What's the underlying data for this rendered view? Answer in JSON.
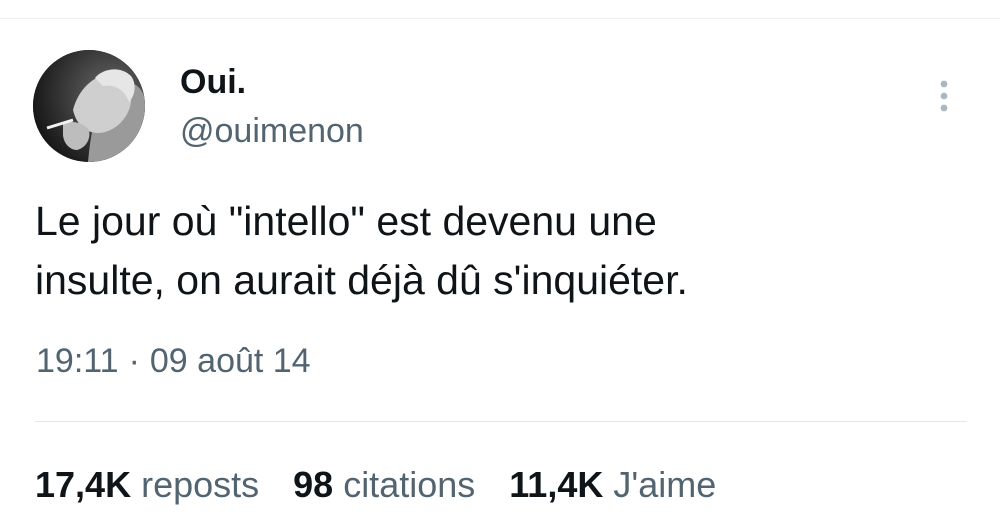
{
  "tweet": {
    "author": {
      "display_name": "Oui.",
      "handle": "@ouimenon",
      "avatar_icon": "profile-photo"
    },
    "menu_icon": "more-vertical-icon",
    "text": "Le jour où \"intello\" est devenu une\ninsulte, on aurait déjà dû s'inquiéter.",
    "time": "19:11",
    "separator": "·",
    "date": "09 août 14",
    "stats": {
      "reposts": {
        "count": "17,4K",
        "label": "reposts"
      },
      "quotes": {
        "count": "98",
        "label": "citations"
      },
      "likes": {
        "count": "11,4K",
        "label": "J'aime"
      }
    }
  },
  "colors": {
    "text_primary": "#0f1419",
    "text_secondary": "#536471",
    "divider": "#e1e8ed",
    "menu_dots": "#aab8c2"
  }
}
